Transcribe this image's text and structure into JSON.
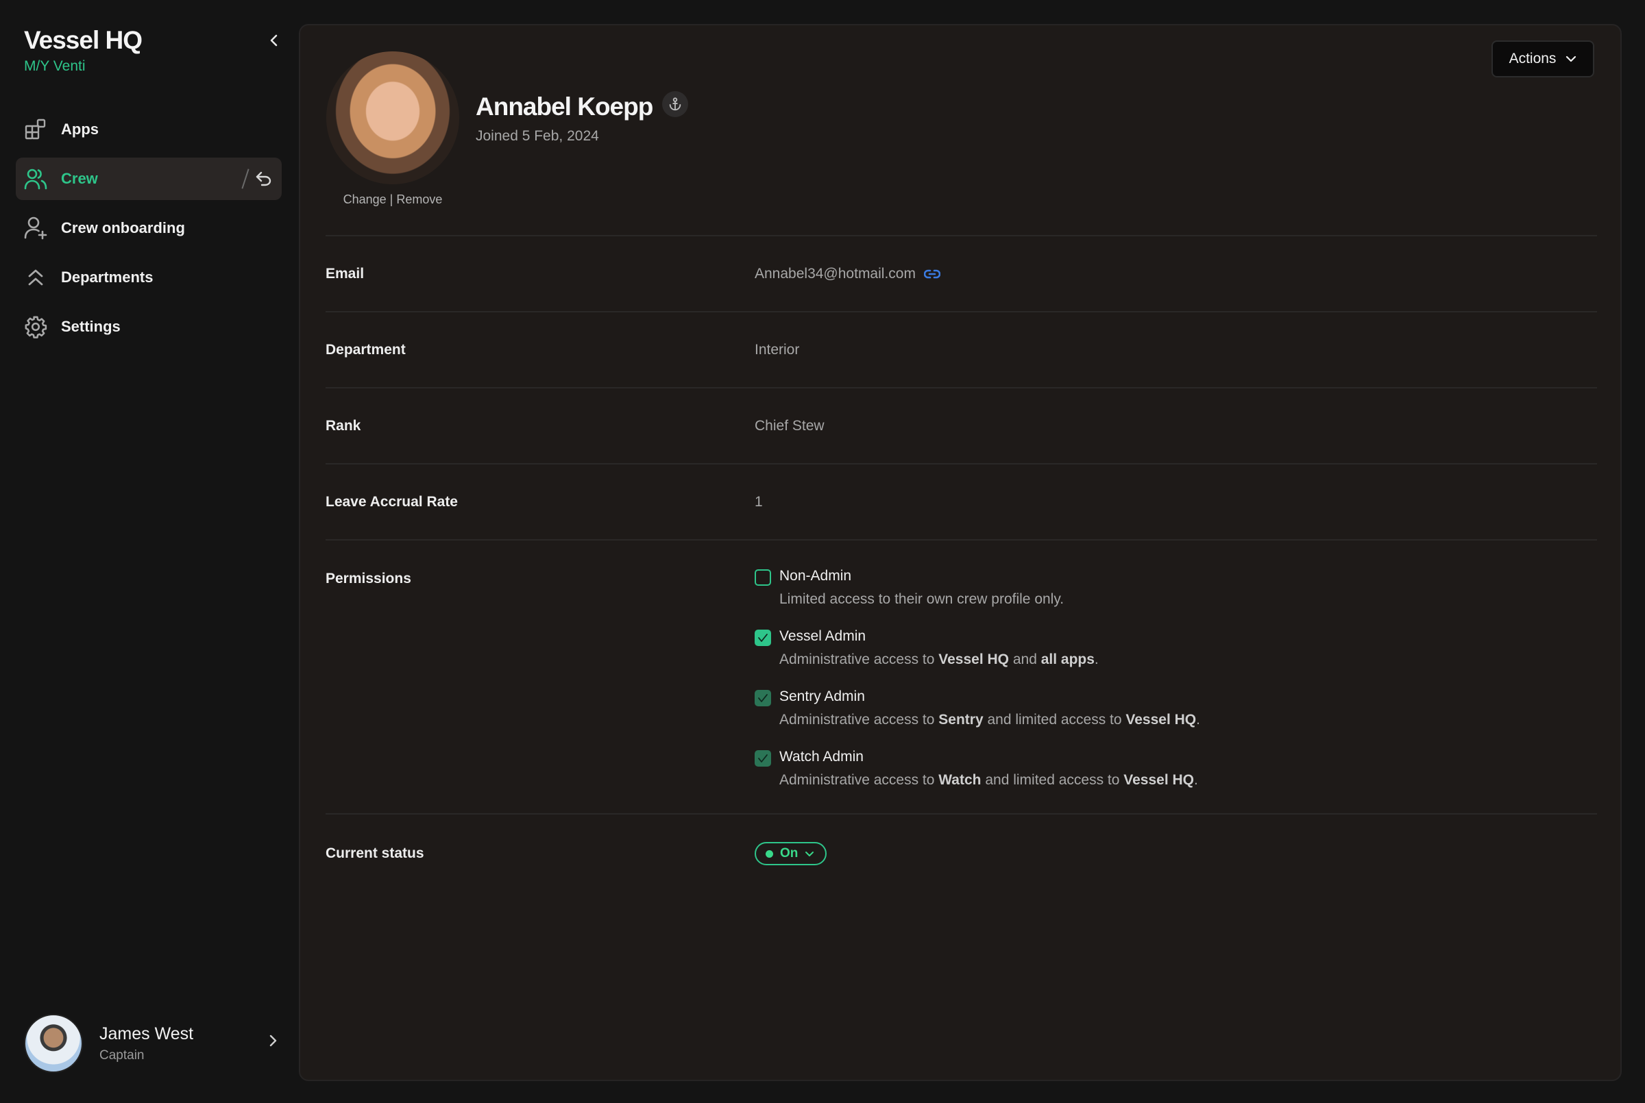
{
  "sidebar": {
    "title": "Vessel HQ",
    "vessel": "M/Y Venti",
    "items": [
      {
        "label": "Apps",
        "icon": "apps-icon"
      },
      {
        "label": "Crew",
        "icon": "crew-icon",
        "active": true
      },
      {
        "label": "Crew onboarding",
        "icon": "user-plus-icon"
      },
      {
        "label": "Departments",
        "icon": "chevrons-up-icon"
      },
      {
        "label": "Settings",
        "icon": "gear-icon"
      }
    ],
    "user": {
      "name": "James West",
      "role": "Captain"
    }
  },
  "profile": {
    "name": "Annabel Koepp",
    "joined": "Joined 5 Feb, 2024",
    "avatar_change": "Change",
    "avatar_separator": " | ",
    "avatar_remove": "Remove",
    "actions_label": "Actions"
  },
  "fields": {
    "email": {
      "label": "Email",
      "value": "Annabel34@hotmail.com"
    },
    "department": {
      "label": "Department",
      "value": "Interior"
    },
    "rank": {
      "label": "Rank",
      "value": "Chief Stew"
    },
    "leave": {
      "label": "Leave Accrual Rate",
      "value": "1"
    }
  },
  "permissions": {
    "label": "Permissions",
    "items": [
      {
        "title": "Non-Admin",
        "checked": false,
        "desc": [
          "Limited access to their own crew profile only."
        ]
      },
      {
        "title": "Vessel Admin",
        "checked": true,
        "desc": [
          "Administrative access to ",
          "Vessel HQ",
          " and ",
          "all apps",
          "."
        ]
      },
      {
        "title": "Sentry Admin",
        "checked": true,
        "desc": [
          "Administrative access to ",
          "Sentry",
          " and limited access to ",
          "Vessel HQ",
          "."
        ]
      },
      {
        "title": "Watch Admin",
        "checked": true,
        "desc": [
          "Administrative access to ",
          "Watch",
          " and limited access to ",
          "Vessel HQ",
          "."
        ]
      }
    ]
  },
  "status": {
    "label": "Current status",
    "value": "On"
  },
  "colors": {
    "accent": "#2ec58a",
    "link": "#3b7be0",
    "background": "#141414",
    "card": "#1e1a18"
  }
}
